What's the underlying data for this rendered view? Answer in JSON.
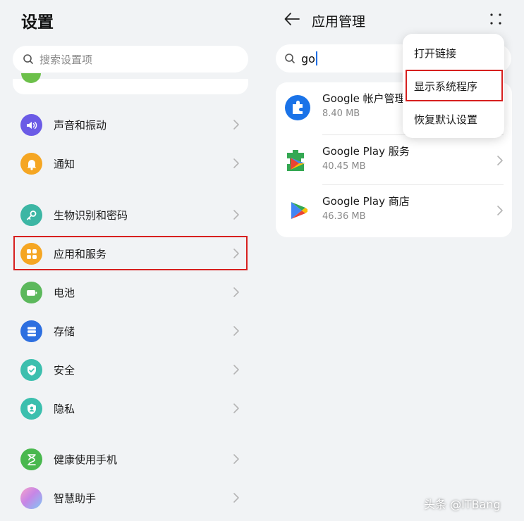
{
  "settings": {
    "title": "设置",
    "search_placeholder": "搜索设置项",
    "groups": [
      {
        "items": [
          {
            "label": "声音和振动",
            "icon": "speaker-icon",
            "color": "#6b5be6"
          },
          {
            "label": "通知",
            "icon": "bell-icon",
            "color": "#f5a623"
          }
        ]
      },
      {
        "items": [
          {
            "label": "生物识别和密码",
            "icon": "key-icon",
            "color": "#3cb6a4"
          },
          {
            "label": "应用和服务",
            "icon": "apps-grid-icon",
            "color": "#f5a623"
          },
          {
            "label": "电池",
            "icon": "battery-icon",
            "color": "#5cb85c"
          },
          {
            "label": "存储",
            "icon": "storage-icon",
            "color": "#2d6fe0"
          },
          {
            "label": "安全",
            "icon": "shield-check-icon",
            "color": "#3cbfae"
          },
          {
            "label": "隐私",
            "icon": "privacy-icon",
            "color": "#3cbfae"
          }
        ]
      },
      {
        "items": [
          {
            "label": "健康使用手机",
            "icon": "hourglass-icon",
            "color": "#49b84e"
          },
          {
            "label": "智慧助手",
            "icon": "assistant-icon",
            "color": "#c686e6"
          }
        ]
      }
    ]
  },
  "app_management": {
    "title": "应用管理",
    "search_value": "go",
    "apps": [
      {
        "name": "Google 帐户管理",
        "size": "8.40 MB",
        "icon": "google-account-icon"
      },
      {
        "name": "Google Play 服务",
        "size": "40.45 MB",
        "icon": "play-services-icon"
      },
      {
        "name": "Google Play 商店",
        "size": "46.36 MB",
        "icon": "play-store-icon"
      }
    ],
    "menu": [
      "打开链接",
      "显示系统程序",
      "恢复默认设置"
    ]
  },
  "watermark": "头条 @ITBang",
  "colors": {
    "highlight": "#d7201f",
    "caret": "#1f6fe6",
    "background": "#f1f3f5"
  }
}
